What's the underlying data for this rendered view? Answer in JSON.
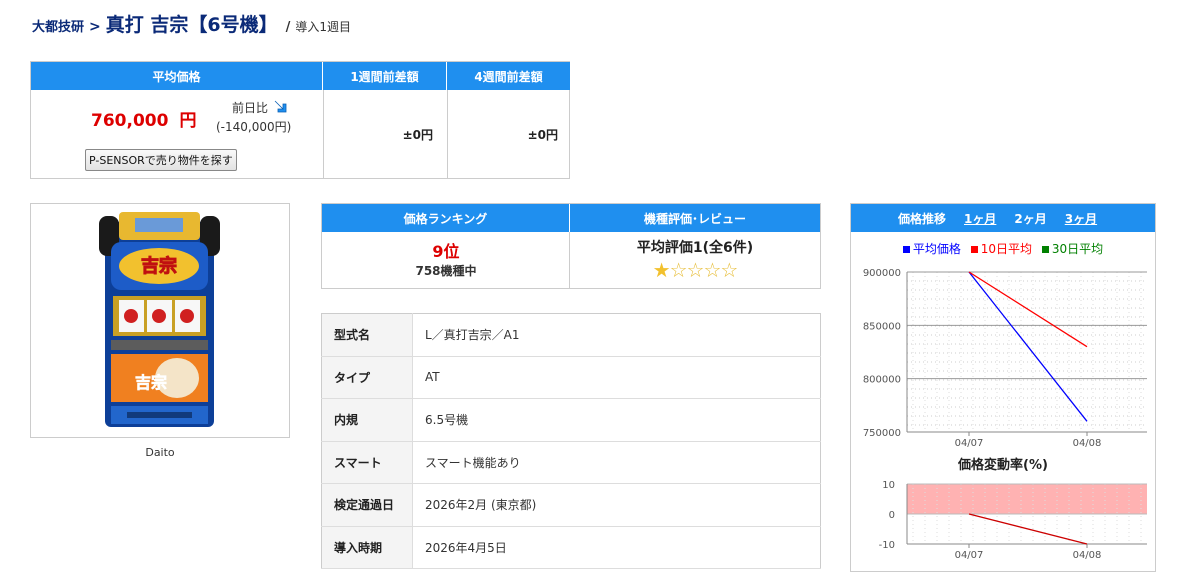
{
  "breadcrumb": {
    "maker": "大都技研",
    "separator": ">",
    "title": "真打 吉宗【6号機】",
    "slash": "/",
    "week": "導入1週目"
  },
  "price": {
    "headers": [
      "平均価格",
      "1週間前差額",
      "4週間前差額"
    ],
    "value": "760,000",
    "unit": "円",
    "compare_label": "前日比",
    "compare_value": "(-140,000円)",
    "trend_icon": "arrow-down-right-icon",
    "button": "P-SENSORで売り物件を探す",
    "diff_1w": "±0円",
    "diff_4w": "±0円"
  },
  "machine": {
    "maker_caption": "Daito",
    "image_label": "真打吉宗"
  },
  "ranking": {
    "headers": [
      "価格ランキング",
      "機種評価･レビュー"
    ],
    "rank": "9位",
    "rank_sub": "758機種中",
    "review": "平均評価1(全6件)",
    "rating": 1,
    "rating_max": 5
  },
  "spec": {
    "rows": [
      {
        "key": "型式名",
        "value": "L／真打吉宗／A1"
      },
      {
        "key": "タイプ",
        "value": "AT"
      },
      {
        "key": "内規",
        "value": "6.5号機"
      },
      {
        "key": "スマート",
        "value": "スマート機能あり"
      },
      {
        "key": "検定通過日",
        "value": "2026年2月 (東京都)"
      },
      {
        "key": "導入時期",
        "value": "2026年4月5日"
      }
    ]
  },
  "chart_panel": {
    "title": "価格推移",
    "tabs": [
      "1ヶ月",
      "2ヶ月",
      "3ヶ月"
    ],
    "legend": [
      "平均価格",
      "10日平均",
      "30日平均"
    ],
    "colors": {
      "avg": "#0000ff",
      "avg10": "#ff0000",
      "avg30": "#008000",
      "header": "#1f8fef",
      "band": "#ffaaaa"
    }
  },
  "chart_data": [
    {
      "type": "line",
      "categories": [
        "04/07",
        "04/08"
      ],
      "series": [
        {
          "name": "平均価格",
          "values": [
            900000,
            760000
          ]
        },
        {
          "name": "10日平均",
          "values": [
            900000,
            830000
          ]
        }
      ],
      "ylim": [
        750000,
        900000
      ],
      "yticks": [
        "900000",
        "850000",
        "800000",
        "750000"
      ],
      "xticks": [
        "04/07",
        "04/08"
      ]
    },
    {
      "type": "line",
      "title": "価格変動率(%)",
      "categories": [
        "04/07",
        "04/08"
      ],
      "series": [
        {
          "values": [
            0,
            -10
          ]
        }
      ],
      "ylim": [
        -10,
        10
      ],
      "yticks": [
        "10",
        "0",
        "-10"
      ],
      "xticks": [
        "04/07",
        "04/08"
      ],
      "band": [
        0,
        10
      ]
    }
  ]
}
